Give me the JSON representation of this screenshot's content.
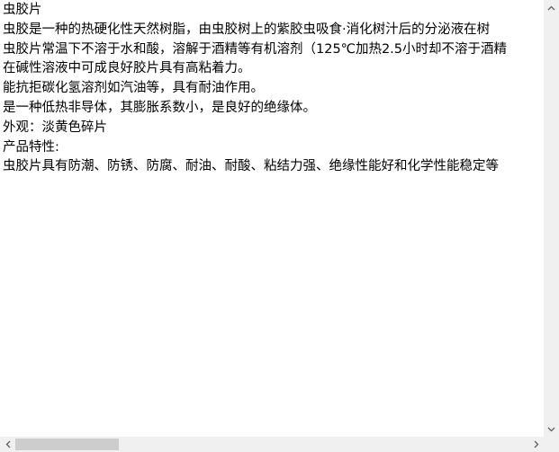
{
  "document": {
    "lines": [
      "虫胶片",
      "虫胶是一种的热硬化性天然树脂，由虫胶树上的紫胶虫吸食·消化树汁后的分泌液在树",
      "虫胶片常温下不溶于水和酸，溶解于酒精等有机溶剂（125℃加热2.5小时却不溶于酒精",
      "在碱性溶液中可成良好胶片具有高粘着力。",
      "能抗拒碳化氢溶剂如汽油等，具有耐油作用。",
      "是一种低热非导体，其膨胀系数小，是良好的绝缘体。",
      "外观：淡黄色碎片",
      "产品特性:",
      "虫胶片具有防潮、防锈、防腐、耐油、耐酸、粘结力强、绝缘性能好和化学性能稳定等"
    ]
  },
  "scrollbars": {
    "arrow_color": "#606060",
    "track_color": "#f0f0f0",
    "thumb_color": "#cdcdcd",
    "icons": {
      "up": "chevron-up-icon",
      "down": "chevron-down-icon",
      "left": "chevron-left-icon",
      "right": "chevron-right-icon"
    }
  }
}
